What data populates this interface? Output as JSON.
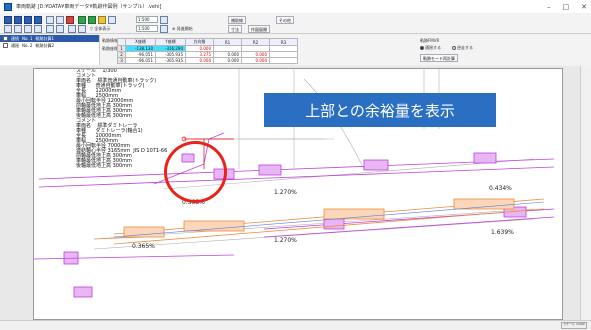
{
  "window": {
    "title": "車両軌跡 [D:¥DATA¥車両データ¥軌跡作図例（サンプル）.vehi]",
    "controls": [
      "–",
      "□",
      "✕"
    ]
  },
  "toolbar": {
    "zoom_value": "1:500",
    "scale_value": "1:500",
    "show_all_label": "▽ 全体表示",
    "start_label": "⊕ 発進開始",
    "aux_label": "補助線",
    "dimension_label": "寸法",
    "display_setting_label": "作図展開",
    "other_label": "その他"
  },
  "tree": {
    "items": [
      {
        "label": "連続",
        "no": "No. 1",
        "name": "軌跡計算1"
      },
      {
        "label": "通過",
        "no": "No. 2",
        "name": "軌跡計算2"
      }
    ]
  },
  "table": {
    "left_labels": [
      "軌跡情報",
      "軌跡座標"
    ],
    "headers": [
      "",
      "X座標",
      "Y座標",
      "方向角",
      "R1",
      "R2",
      "R3"
    ],
    "rows": [
      {
        "n": "1",
        "x": "-138.130",
        "y": "-316.290",
        "a": "0.000",
        "r1": "",
        "r2": "",
        "r3": ""
      },
      {
        "n": "2",
        "x": "-96.051",
        "y": "-305.935",
        "a": "3.275",
        "r1": "0.000",
        "r2": "0.000",
        "r3": ""
      },
      {
        "n": "3",
        "x": "-96.051",
        "y": "-305.935",
        "a": "0.000",
        "r1": "0.000",
        "r2": "0.000",
        "r3": ""
      }
    ],
    "options_title": "軌跡FMVR",
    "option1": "通過する",
    "option2": "逆走する",
    "redraw_button": "軌跡モード再計算"
  },
  "drawing": {
    "notes": "スケール    1/300\nコメント\n車両名    標準普通自動車(トラック)\n車種      普通自動車(トラック)\n全長      12000mm\n車幅      2500mm\n最小回転半径 12000mm\n前軸最低地上高 300mm\n車軸最低地上高 300mm\n後軸最低地上高 300mm\nコメント\n車両名    標準ダミトレーラ\n車種      ダミトレーラ(軸合1)\n全長      10000mm\n車幅      2500mm\n最小回転半径 7000mm\n連結軸心半径 3165mm  JIS D 1071-66\n前軸最低地上高 300mm\n車軸最低地上高 300mm\n後軸最低地上高 300mm",
    "callout_text": "上部との余裕量を表示",
    "angles": [
      "0.365%",
      "1.270%",
      "0.434%",
      "0.365%",
      "1.270%",
      "1.639%"
    ]
  },
  "statusbar": {
    "cell_text": "スケール 1/300"
  },
  "colors": {
    "callout_bg": "#2a6fc2",
    "ring": "#e8231a",
    "truck_magenta": "#c040e0",
    "trailer_orange": "#f08a3c",
    "highlight_cell": "#3fe0ff"
  }
}
